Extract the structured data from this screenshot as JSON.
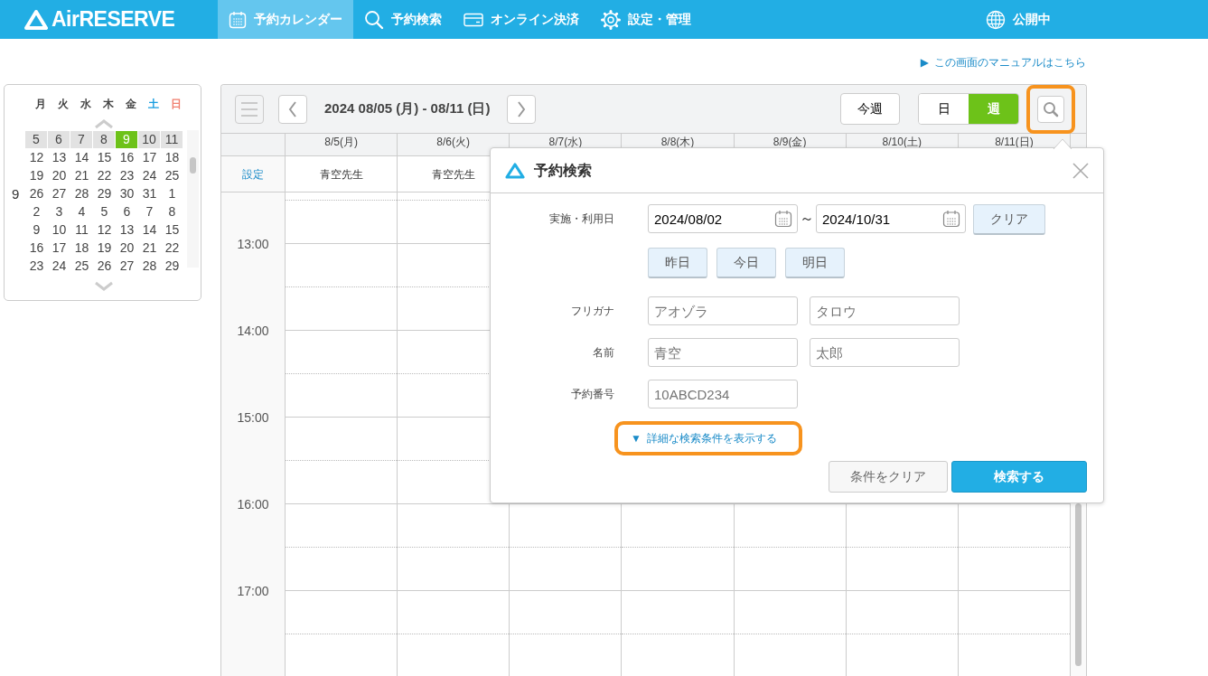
{
  "header": {
    "logo": "AirRESERVE",
    "nav": [
      {
        "label": "予約カレンダー",
        "selected": true
      },
      {
        "label": "予約検索",
        "selected": false
      },
      {
        "label": "オンライン決済",
        "selected": false
      },
      {
        "label": "設定・管理",
        "selected": false
      }
    ],
    "status": "公開中"
  },
  "manual_link": {
    "marker": "▶",
    "label": "この画面のマニュアルはこちら"
  },
  "mini_calendar": {
    "weekdays": [
      {
        "label": "月",
        "kind": "weekday"
      },
      {
        "label": "火",
        "kind": "weekday"
      },
      {
        "label": "水",
        "kind": "weekday"
      },
      {
        "label": "木",
        "kind": "weekday"
      },
      {
        "label": "金",
        "kind": "weekday"
      },
      {
        "label": "土",
        "kind": "saturday"
      },
      {
        "label": "日",
        "kind": "sunday"
      }
    ],
    "weeks": [
      {
        "current": true,
        "days": [
          {
            "label": "5",
            "selected": false
          },
          {
            "label": "6",
            "selected": false
          },
          {
            "label": "7",
            "selected": false
          },
          {
            "label": "8",
            "selected": false
          },
          {
            "label": "9",
            "selected": true
          },
          {
            "label": "10",
            "selected": false
          },
          {
            "label": "11",
            "selected": false
          }
        ]
      },
      {
        "current": false,
        "days": [
          {
            "label": "12",
            "selected": false
          },
          {
            "label": "13",
            "selected": false
          },
          {
            "label": "14",
            "selected": false
          },
          {
            "label": "15",
            "selected": false
          },
          {
            "label": "16",
            "selected": false
          },
          {
            "label": "17",
            "selected": false
          },
          {
            "label": "18",
            "selected": false
          }
        ]
      },
      {
        "current": false,
        "days": [
          {
            "label": "19",
            "selected": false
          },
          {
            "label": "20",
            "selected": false
          },
          {
            "label": "21",
            "selected": false
          },
          {
            "label": "22",
            "selected": false
          },
          {
            "label": "23",
            "selected": false
          },
          {
            "label": "24",
            "selected": false
          },
          {
            "label": "25",
            "selected": false
          }
        ]
      },
      {
        "current": false,
        "month": "9",
        "days": [
          {
            "label": "26",
            "selected": false
          },
          {
            "label": "27",
            "selected": false
          },
          {
            "label": "28",
            "selected": false
          },
          {
            "label": "29",
            "selected": false
          },
          {
            "label": "30",
            "selected": false
          },
          {
            "label": "31",
            "selected": false
          },
          {
            "label": "1",
            "selected": false
          }
        ]
      },
      {
        "current": false,
        "days": [
          {
            "label": "2",
            "selected": false
          },
          {
            "label": "3",
            "selected": false
          },
          {
            "label": "4",
            "selected": false
          },
          {
            "label": "5",
            "selected": false
          },
          {
            "label": "6",
            "selected": false
          },
          {
            "label": "7",
            "selected": false
          },
          {
            "label": "8",
            "selected": false
          }
        ]
      },
      {
        "current": false,
        "days": [
          {
            "label": "9",
            "selected": false
          },
          {
            "label": "10",
            "selected": false
          },
          {
            "label": "11",
            "selected": false
          },
          {
            "label": "12",
            "selected": false
          },
          {
            "label": "13",
            "selected": false
          },
          {
            "label": "14",
            "selected": false
          },
          {
            "label": "15",
            "selected": false
          }
        ]
      },
      {
        "current": false,
        "days": [
          {
            "label": "16",
            "selected": false
          },
          {
            "label": "17",
            "selected": false
          },
          {
            "label": "18",
            "selected": false
          },
          {
            "label": "19",
            "selected": false
          },
          {
            "label": "20",
            "selected": false
          },
          {
            "label": "21",
            "selected": false
          },
          {
            "label": "22",
            "selected": false
          }
        ]
      },
      {
        "current": false,
        "days": [
          {
            "label": "23",
            "selected": false
          },
          {
            "label": "24",
            "selected": false
          },
          {
            "label": "25",
            "selected": false
          },
          {
            "label": "26",
            "selected": false
          },
          {
            "label": "27",
            "selected": false
          },
          {
            "label": "28",
            "selected": false
          },
          {
            "label": "29",
            "selected": false
          }
        ]
      }
    ]
  },
  "toolbar": {
    "date_range": "2024 08/05 (月) - 08/11 (日)",
    "this_week": "今週",
    "views": [
      {
        "label": "日",
        "selected": false
      },
      {
        "label": "週",
        "selected": true
      }
    ],
    "search_highlighted": true
  },
  "schedule": {
    "settings_label": "設定",
    "columns": [
      {
        "date": "8/5(月)",
        "staff": "青空先生"
      },
      {
        "date": "8/6(火)",
        "staff": "青空先生"
      },
      {
        "date": "8/7(水)"
      },
      {
        "date": "8/8(木)"
      },
      {
        "date": "8/9(金)"
      },
      {
        "date": "8/10(土)"
      },
      {
        "date": "8/11(日)"
      }
    ],
    "times": [
      "13:00",
      "14:00",
      "15:00",
      "16:00",
      "17:00"
    ]
  },
  "search_panel": {
    "title": "予約検索",
    "date": {
      "label": "実施・利用日",
      "from": "2024/08/02",
      "separator": "～",
      "to": "2024/10/31",
      "clear": "クリア",
      "quick": [
        "昨日",
        "今日",
        "明日"
      ]
    },
    "furigana": {
      "label": "フリガナ",
      "placeholders": [
        "アオゾラ",
        "タロウ"
      ]
    },
    "name": {
      "label": "名前",
      "placeholders": [
        "青空",
        "太郎"
      ]
    },
    "number": {
      "label": "予約番号",
      "placeholder": "10ABCD234"
    },
    "details_link": {
      "marker": "▼",
      "label": "詳細な検索条件を表示する",
      "highlighted": true
    },
    "buttons": [
      {
        "label": "条件をクリア",
        "kind": "secondary"
      },
      {
        "label": "検索する",
        "kind": "primary"
      }
    ]
  }
}
